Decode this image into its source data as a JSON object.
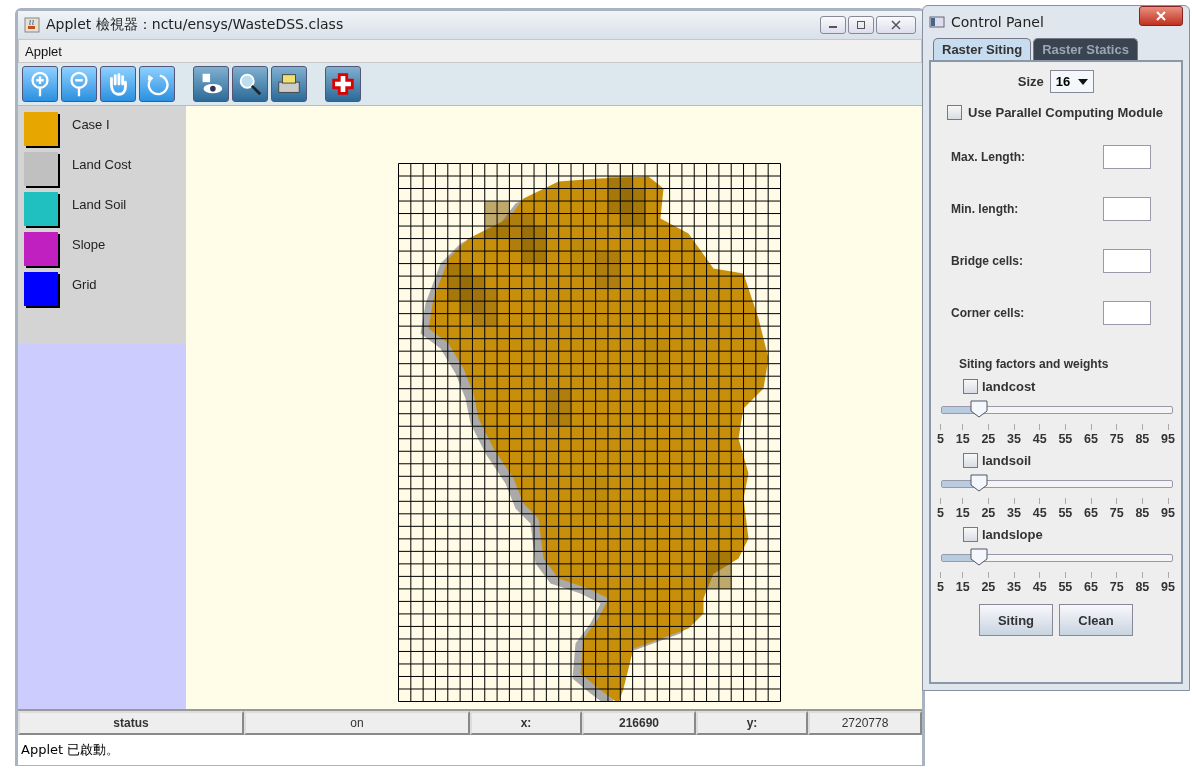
{
  "window": {
    "title": "Applet 檢視器：nctu/ensys/WasteDSS.class"
  },
  "menu": [
    "Applet"
  ],
  "legend": [
    {
      "label": "Case I",
      "color": "#e8a600"
    },
    {
      "label": "Land Cost",
      "color": "#c0c0c0"
    },
    {
      "label": "Land Soil",
      "color": "#20c0c0"
    },
    {
      "label": "Slope",
      "color": "#c020c0"
    },
    {
      "label": "Grid",
      "color": "#0000ff"
    }
  ],
  "status_bar": [
    {
      "text": "status",
      "bold": true
    },
    {
      "text": "on",
      "bold": false
    },
    {
      "text": "x:",
      "bold": true
    },
    {
      "text": "216690",
      "bold": true
    },
    {
      "text": "y:",
      "bold": true
    },
    {
      "text": "2720778",
      "bold": false
    }
  ],
  "applet_message": "Applet 已啟動。",
  "control_panel": {
    "title": "Control Panel",
    "tabs": [
      {
        "label": "Raster Siting",
        "selected": true
      },
      {
        "label": "Raster Statics",
        "selected": false
      }
    ],
    "size": {
      "label": "Size",
      "value": "16"
    },
    "parallel": {
      "label": "Use Parallel Computing Module",
      "checked": false
    },
    "fields": [
      {
        "label": "Max. Length:"
      },
      {
        "label": "Min. length:"
      },
      {
        "label": "Bridge cells:"
      },
      {
        "label": "Corner cells:"
      }
    ],
    "factors_title": "Siting factors and weights",
    "factors": [
      {
        "label": "landcost",
        "checked": false,
        "level": 0.16,
        "ticks": [
          "5",
          "15",
          "25",
          "35",
          "45",
          "55",
          "65",
          "75",
          "85",
          "95"
        ]
      },
      {
        "label": "landsoil",
        "checked": false,
        "level": 0.16,
        "ticks": [
          "5",
          "15",
          "25",
          "35",
          "45",
          "55",
          "65",
          "75",
          "85",
          "95"
        ]
      },
      {
        "label": "landslope",
        "checked": false,
        "level": 0.16,
        "ticks": [
          "5",
          "15",
          "25",
          "35",
          "45",
          "55",
          "65",
          "75",
          "85",
          "95"
        ]
      }
    ],
    "buttons": [
      "Siting",
      "Clean"
    ]
  }
}
